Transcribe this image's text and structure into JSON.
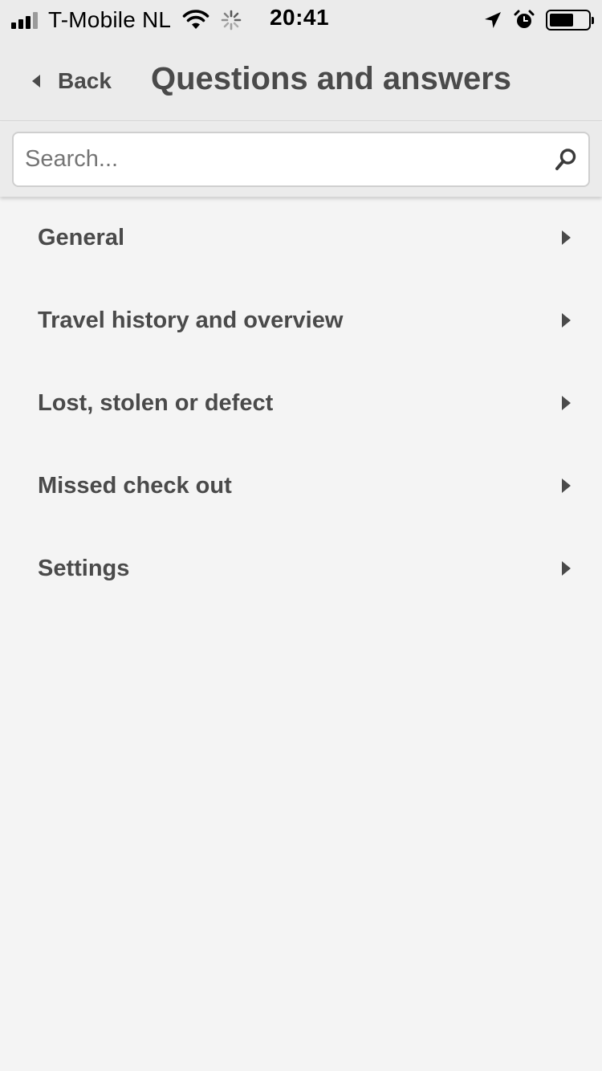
{
  "status_bar": {
    "carrier": "T-Mobile NL",
    "time": "20:41",
    "icons": [
      "signal-icon",
      "wifi-icon",
      "activity-icon",
      "location-icon",
      "alarm-icon",
      "battery-icon"
    ]
  },
  "nav": {
    "back_label": "Back",
    "title": "Questions and answers"
  },
  "search": {
    "placeholder": "Search...",
    "value": ""
  },
  "categories": [
    {
      "label": "General"
    },
    {
      "label": "Travel history and overview"
    },
    {
      "label": "Lost, stolen or defect"
    },
    {
      "label": "Missed check out"
    },
    {
      "label": "Settings"
    }
  ],
  "colors": {
    "background": "#f4f4f4",
    "bar": "#ebebeb",
    "text": "#4a4a4a"
  }
}
